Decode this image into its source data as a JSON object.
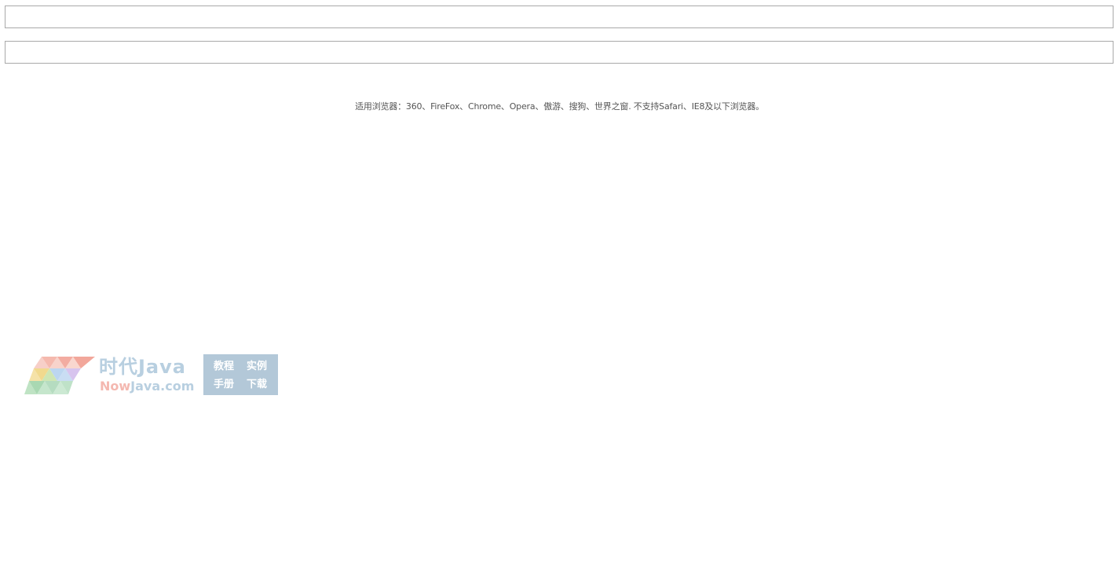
{
  "inputs": {
    "first_value": "",
    "second_value": ""
  },
  "notice": {
    "text": "适用浏览器：360、FireFox、Chrome、Opera、傲游、搜狗、世界之窗. 不支持Safari、IE8及以下浏览器。"
  },
  "watermark": {
    "title": "时代Java",
    "domain_prefix": "Now",
    "domain_suffix": "Java.com",
    "panel": {
      "item1": "教程",
      "item2": "实例",
      "item3": "手册",
      "item4": "下载"
    },
    "colors": {
      "text_blue": "#b8cfe0",
      "text_pink": "#f4b8b0",
      "panel_bg": "#b3c8d8"
    }
  }
}
